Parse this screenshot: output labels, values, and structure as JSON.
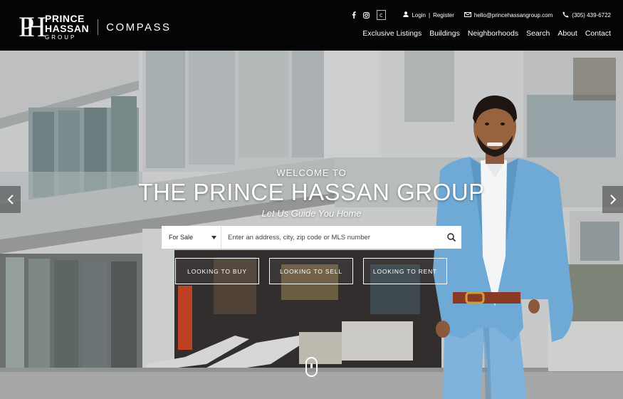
{
  "brand": {
    "monogram_p": "P",
    "monogram_h": "H",
    "line1": "PRINCE",
    "line2": "HASSAN",
    "line3": "GROUP",
    "partner": "COMPASS"
  },
  "utility": {
    "icons": [
      "facebook-icon",
      "instagram-icon",
      "app-icon"
    ],
    "login": "Login",
    "separator": "|",
    "register": "Register",
    "email": "hello@princehassangroup.com",
    "phone": "(305) 439-6722"
  },
  "nav": {
    "items": [
      "Exclusive Listings",
      "Buildings",
      "Neighborhoods",
      "Search",
      "About",
      "Contact"
    ]
  },
  "hero": {
    "eyebrow": "WELCOME TO",
    "title": "THE PRINCE HASSAN GROUP",
    "tagline": "Let Us Guide You Home"
  },
  "search": {
    "select_value": "For Sale",
    "placeholder": "Enter an address, city, zip code or MLS number"
  },
  "cta": {
    "buy": "LOOKING TO BUY",
    "sell": "LOOKING TO SELL",
    "rent": "LOOKING TO RENT"
  },
  "colors": {
    "header_bg": "#040404",
    "suit": "#6fa9d6",
    "belt": "#8a3a24"
  }
}
